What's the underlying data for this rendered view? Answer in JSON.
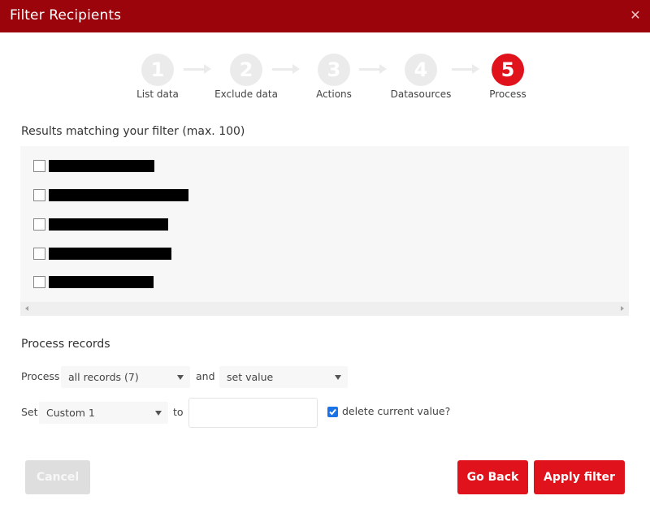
{
  "dialog": {
    "title": "Filter Recipients",
    "close_icon": "close-icon"
  },
  "colors": {
    "header": "#9b040b",
    "accent": "#e0121b",
    "inactive_step": "#ebebeb",
    "checkbox_checked": "#1a73e8"
  },
  "steps": [
    {
      "number": "1",
      "label": "List data",
      "active": false
    },
    {
      "number": "2",
      "label": "Exclude data",
      "active": false
    },
    {
      "number": "3",
      "label": "Actions",
      "active": false
    },
    {
      "number": "4",
      "label": "Datasources",
      "active": false
    },
    {
      "number": "5",
      "label": "Process",
      "active": true
    }
  ],
  "results": {
    "title": "Results matching your filter (max. 100)",
    "rows": [
      {
        "checked": false,
        "text": "[redacted]"
      },
      {
        "checked": false,
        "text": "[redacted]"
      },
      {
        "checked": false,
        "text": "[redacted]"
      },
      {
        "checked": false,
        "text": "[redacted]"
      },
      {
        "checked": false,
        "text": "[redacted]"
      }
    ]
  },
  "process": {
    "title": "Process records",
    "process_label": "Process",
    "records_select": "all records (7)",
    "and_label": "and",
    "action_select": "set value",
    "set_label": "Set",
    "field_select": "Custom 1",
    "to_label": "to",
    "value_input": "",
    "delete_current_checked": true,
    "delete_current_label": "delete current value?"
  },
  "buttons": {
    "cancel": "Cancel",
    "go_back": "Go Back",
    "apply": "Apply filter"
  }
}
